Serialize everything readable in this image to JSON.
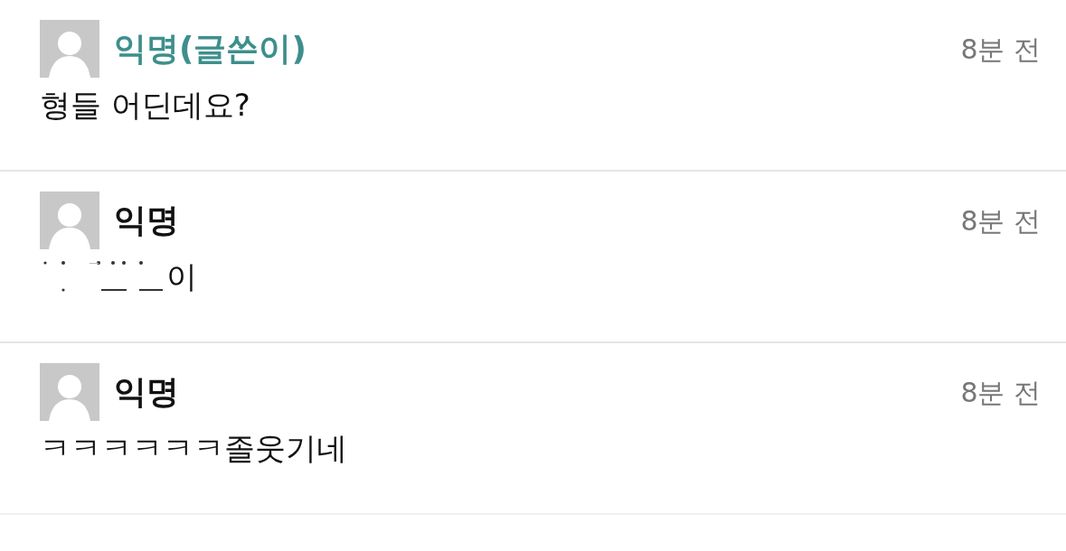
{
  "comments": [
    {
      "author": "익명(글쓴이)",
      "is_author": true,
      "time": "8분 전",
      "body": "형들 어딘데요?"
    },
    {
      "author": "익명",
      "is_author": false,
      "time": "8분 전",
      "body": "이",
      "body_erased": true
    },
    {
      "author": "익명",
      "is_author": false,
      "time": "8분 전",
      "body": "ㅋㅋㅋㅋㅋㅋ졸웃기네"
    }
  ]
}
